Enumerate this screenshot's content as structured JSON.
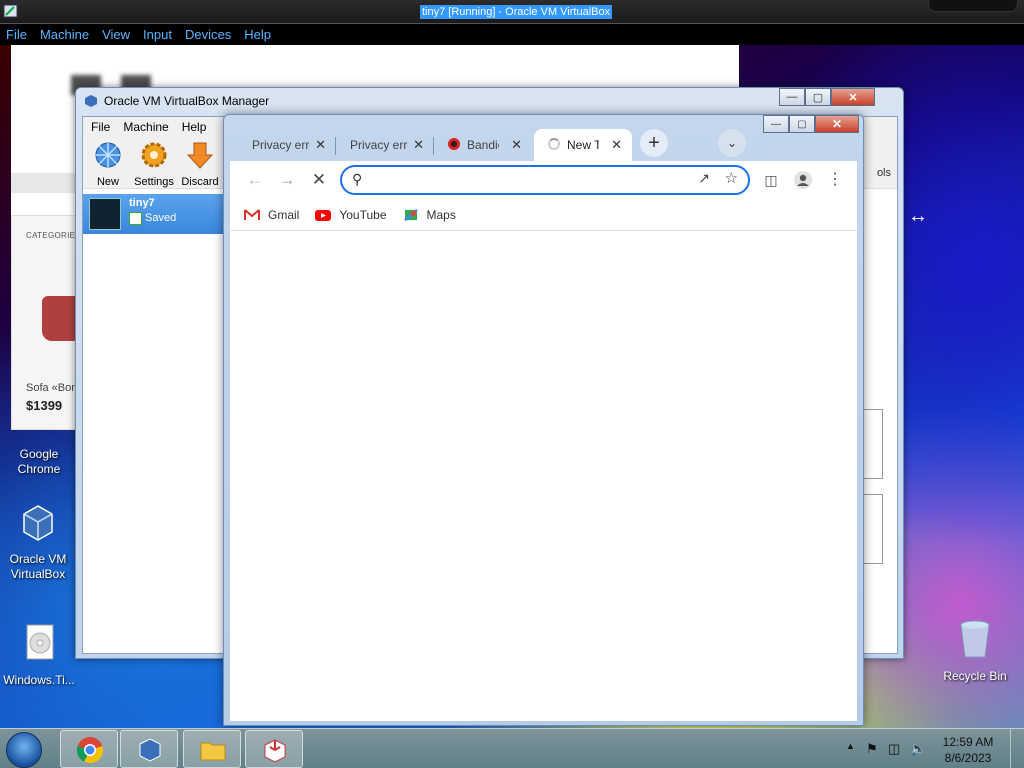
{
  "host": {
    "title": "tiny7 [Running] - Oracle VM VirtualBox",
    "menu": [
      "File",
      "Machine",
      "View",
      "Input",
      "Devices",
      "Help"
    ]
  },
  "shop": {
    "categories_label": "CATEGORIES",
    "product_name": "Sofa «Born",
    "product_price": "$1399"
  },
  "desktop_icons": [
    {
      "label_1": "Google",
      "label_2": "Chrome",
      "icon": "chrome-icon"
    },
    {
      "label_1": "Oracle VM",
      "label_2": "VirtualBox",
      "icon": "virtualbox-icon"
    },
    {
      "label_1": "Windows.Ti...",
      "label_2": "",
      "icon": "disc-image-icon"
    },
    {
      "label_1": "Recycle Bin",
      "label_2": "",
      "icon": "recycle-bin-icon"
    }
  ],
  "vbox_manager": {
    "title": "Oracle VM VirtualBox Manager",
    "menu": [
      "File",
      "Machine",
      "Help"
    ],
    "toolbar": {
      "new": "New",
      "settings": "Settings",
      "discard": "Discard"
    },
    "vm": {
      "name": "tiny7",
      "state": "Saved"
    },
    "tools_stub": "ols"
  },
  "chrome": {
    "tabs": [
      {
        "label": "Privacy error",
        "icon": "",
        "active": false
      },
      {
        "label": "Privacy error",
        "icon": "",
        "active": false
      },
      {
        "label": "Bandicam",
        "icon": "bandicam-icon",
        "active": false
      },
      {
        "label": "New Tab",
        "icon": "loading-spinner-icon",
        "active": true
      }
    ],
    "new_tab_symbol": "+",
    "omnibox": {
      "value": "",
      "placeholder": ""
    },
    "bookmarks": [
      {
        "label": "Gmail",
        "icon": "gmail-icon"
      },
      {
        "label": "YouTube",
        "icon": "youtube-icon"
      },
      {
        "label": "Maps",
        "icon": "maps-icon"
      }
    ]
  },
  "taskbar": {
    "time": "12:59 AM",
    "date": "8/6/2023"
  }
}
